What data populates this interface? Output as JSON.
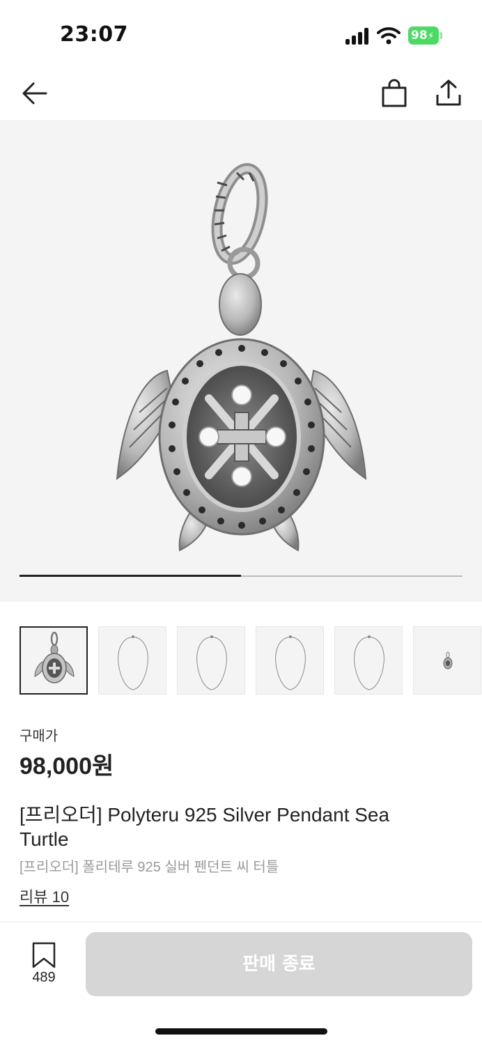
{
  "status_bar": {
    "time": "23:07",
    "battery": "98"
  },
  "nav": {
    "icons": [
      "back-arrow-icon",
      "shopping-bag-icon",
      "share-icon"
    ]
  },
  "hero": {
    "image": "silver-turtle-pendant",
    "page_index": 1,
    "page_count": 2
  },
  "thumbnails": [
    {
      "image": "turtle-pendant",
      "selected": true
    },
    {
      "image": "chain-necklace",
      "selected": false
    },
    {
      "image": "chain-necklace",
      "selected": false
    },
    {
      "image": "chain-necklace",
      "selected": false
    },
    {
      "image": "chain-necklace",
      "selected": false
    },
    {
      "image": "small-pendant",
      "selected": false
    }
  ],
  "product": {
    "price_label": "구매가",
    "price": "98,000원",
    "title": "[프리오더] Polyteru 925 Silver Pendant Sea Turtle",
    "subtitle": "[프리오더] 폴리테루 925 실버 펜던트 씨 터틀",
    "reviews": "리뷰 10"
  },
  "bottom_bar": {
    "bookmark_count": "489",
    "buy_button_label": "판매 종료",
    "buy_button_enabled": false
  },
  "colors": {
    "text": "#222222",
    "muted": "#9a9a9a",
    "disabled_button": "#d6d6d6",
    "battery": "#4cd964",
    "image_bg": "#f4f4f4"
  }
}
